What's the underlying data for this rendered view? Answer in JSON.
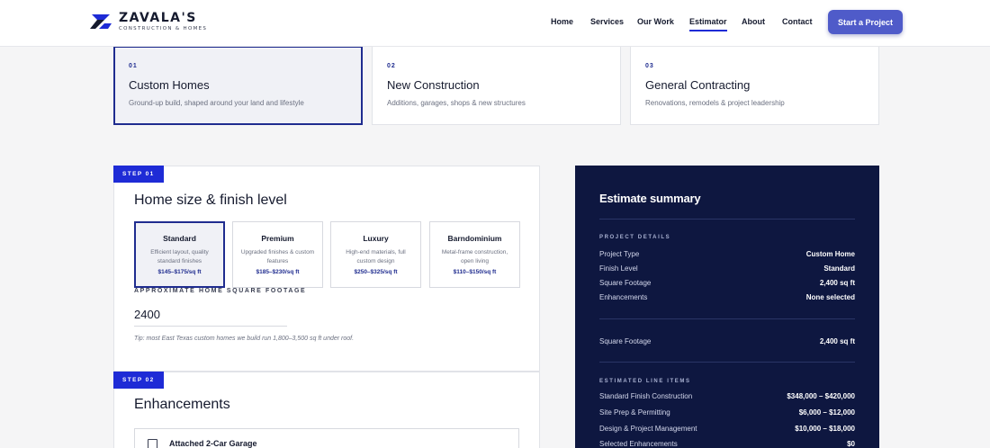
{
  "brand": {
    "name": "ZAVALA'S",
    "tagline": "CONSTRUCTION & HOMES",
    "accent": "#1e2bd6",
    "navy": "#0e1740"
  },
  "nav": {
    "items": [
      {
        "label": "Home"
      },
      {
        "label": "Services"
      },
      {
        "label": "Our Work"
      },
      {
        "label": "Estimator",
        "active": true
      },
      {
        "label": "About"
      },
      {
        "label": "Contact"
      }
    ],
    "cta": "Start a Project"
  },
  "project_types": [
    {
      "num": "01",
      "title": "Custom Homes",
      "desc": "Ground-up build, shaped around your land and lifestyle",
      "selected": true
    },
    {
      "num": "02",
      "title": "New Construction",
      "desc": "Additions, garages, shops & new structures",
      "selected": false
    },
    {
      "num": "03",
      "title": "General Contracting",
      "desc": "Renovations, remodels & project leadership",
      "selected": false
    }
  ],
  "step1": {
    "badge": "STEP 01",
    "title": "Home size & finish level",
    "finishes": [
      {
        "name": "Standard",
        "desc": "Efficient layout, quality standard finishes",
        "price": "$145–$175/sq ft",
        "selected": true
      },
      {
        "name": "Premium",
        "desc": "Upgraded finishes & custom features",
        "price": "$185–$230/sq ft",
        "selected": false
      },
      {
        "name": "Luxury",
        "desc": "High-end materials, full custom design",
        "price": "$250–$325/sq ft",
        "selected": false
      },
      {
        "name": "Barndominium",
        "desc": "Metal-frame construction, open living",
        "price": "$110–$150/sq ft",
        "selected": false
      }
    ],
    "sqft_label": "APPROXIMATE HOME SQUARE FOOTAGE",
    "sqft_value": "2400",
    "tip": "Tip: most East Texas custom homes we build run 1,800–3,500 sq ft under roof."
  },
  "step2": {
    "badge": "STEP 02",
    "title": "Enhancements",
    "items": [
      {
        "name": "Attached 2-Car Garage",
        "checked": false
      }
    ]
  },
  "summary": {
    "title": "Estimate summary",
    "details_label": "PROJECT DETAILS",
    "details": [
      {
        "k": "Project Type",
        "v": "Custom Home"
      },
      {
        "k": "Finish Level",
        "v": "Standard"
      },
      {
        "k": "Square Footage",
        "v": "2,400 sq ft"
      },
      {
        "k": "Enhancements",
        "v": "None selected"
      }
    ],
    "sqft_row": {
      "k": "Square Footage",
      "v": "2,400 sq ft"
    },
    "line_items_label": "ESTIMATED LINE ITEMS",
    "line_items": [
      {
        "k": "Standard Finish Construction",
        "v": "$348,000 – $420,000"
      },
      {
        "k": "Site Prep & Permitting",
        "v": "$6,000 – $12,000"
      },
      {
        "k": "Design & Project Management",
        "v": "$10,000 – $18,000"
      },
      {
        "k": "Selected Enhancements",
        "v": "$0"
      }
    ]
  }
}
